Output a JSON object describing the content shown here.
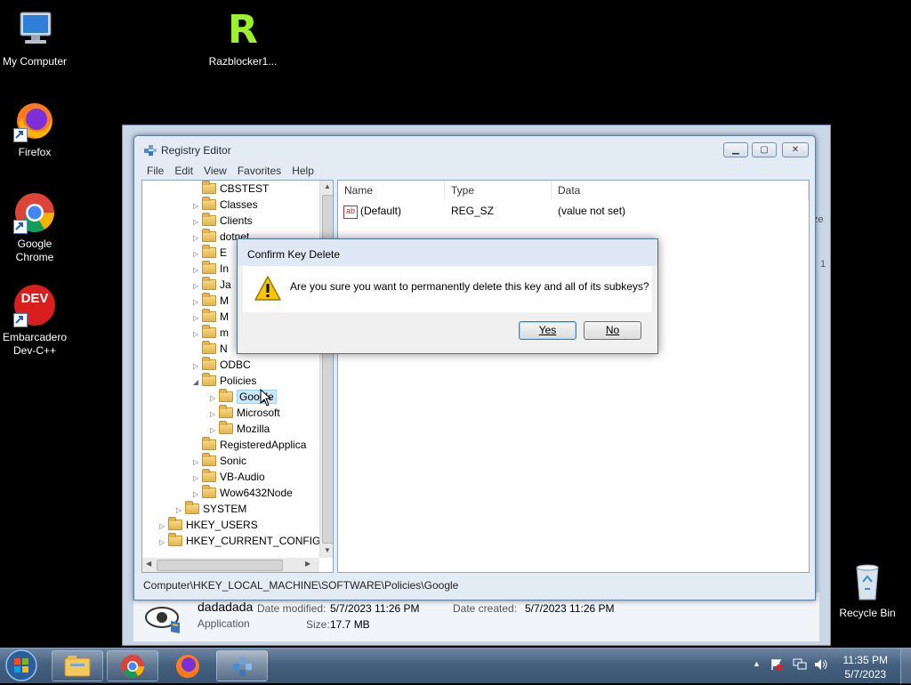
{
  "desktop": {
    "icons": [
      {
        "label": "My Computer"
      },
      {
        "label": "Razblocker1..."
      },
      {
        "label": "Firefox"
      },
      {
        "label": "Google Chrome"
      },
      {
        "label": "Embarcadero Dev-C++"
      },
      {
        "label": "Recycle Bin"
      }
    ],
    "devcpp_logo": "DEV",
    "razblocker_logo": "R"
  },
  "background_window": {
    "file_name": "dadadada",
    "file_type": "Application",
    "date_modified_label": "Date modified:",
    "date_modified": "5/7/2023 11:26 PM",
    "date_created_label": "Date created:",
    "date_created": "5/7/2023 11:26 PM",
    "size_label": "Size:",
    "size": "17.7 MB",
    "edge_text_1": "ze",
    "edge_text_2": "1"
  },
  "regedit": {
    "title": "Registry Editor",
    "menu": [
      "File",
      "Edit",
      "View",
      "Favorites",
      "Help"
    ],
    "tree": [
      {
        "label": "CBSTEST",
        "arrow": ""
      },
      {
        "label": "Classes",
        "arrow": "▷"
      },
      {
        "label": "Clients",
        "arrow": "▷"
      },
      {
        "label": "dotnet",
        "arrow": "▷"
      },
      {
        "label": "E",
        "arrow": "▷"
      },
      {
        "label": "In",
        "arrow": "▷"
      },
      {
        "label": "Ja",
        "arrow": "▷"
      },
      {
        "label": "M",
        "arrow": "▷"
      },
      {
        "label": "M",
        "arrow": "▷"
      },
      {
        "label": "m",
        "arrow": "▷"
      },
      {
        "label": "N",
        "arrow": ""
      },
      {
        "label": "ODBC",
        "arrow": "▷"
      },
      {
        "label": "Policies",
        "arrow": "◢"
      },
      {
        "label": "Google",
        "arrow": "▷"
      },
      {
        "label": "Microsoft",
        "arrow": "▷"
      },
      {
        "label": "Mozilla",
        "arrow": "▷"
      },
      {
        "label": "RegisteredApplica",
        "arrow": ""
      },
      {
        "label": "Sonic",
        "arrow": "▷"
      },
      {
        "label": "VB-Audio",
        "arrow": "▷"
      },
      {
        "label": "Wow6432Node",
        "arrow": "▷"
      },
      {
        "label": "SYSTEM",
        "arrow": "▷"
      },
      {
        "label": "HKEY_USERS",
        "arrow": "▷"
      },
      {
        "label": "HKEY_CURRENT_CONFIG",
        "arrow": "▷"
      }
    ],
    "columns": [
      "Name",
      "Type",
      "Data"
    ],
    "values": [
      {
        "name": "(Default)",
        "type": "REG_SZ",
        "data": "(value not set)"
      }
    ],
    "value_icon": "ab",
    "status_path": "Computer\\HKEY_LOCAL_MACHINE\\SOFTWARE\\Policies\\Google"
  },
  "dialog": {
    "title": "Confirm Key Delete",
    "message": "Are you sure you want to permanently delete this key and all of its subkeys?",
    "yes_label": "Yes",
    "no_label": "No"
  },
  "taskbar": {
    "time": "11:35 PM",
    "date": "5/7/2023"
  },
  "colors": {
    "desktop": "#000000",
    "taskbar": "#45607f",
    "selection": "#cce8ff",
    "warning": "#f7c600"
  }
}
